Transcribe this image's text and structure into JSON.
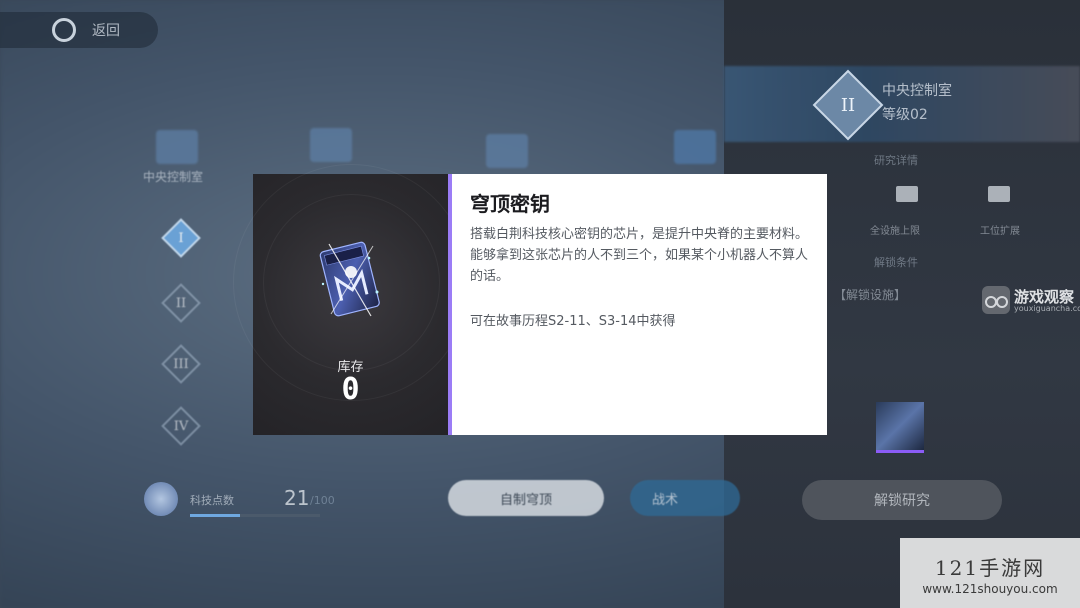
{
  "back": {
    "label": "返回"
  },
  "tree": {
    "categories": [
      "中央控制室",
      "",
      "",
      ""
    ],
    "levels": [
      "I",
      "II",
      "III",
      "IV"
    ]
  },
  "points": {
    "label": "科技点数",
    "value": "21",
    "max": "/100"
  },
  "buttons": {
    "self_made": "自制穹顶",
    "battle": "战术"
  },
  "right_panel": {
    "title": "中央控制室",
    "subtitle": "等级02",
    "level_numeral": "II",
    "research_header": "研究详情",
    "items": [
      "全设施上限",
      "工位扩展"
    ],
    "unlock_header": "解锁条件",
    "condition": "【解锁设施】",
    "unlock_button": "解锁研究"
  },
  "dialog": {
    "stock_label": "库存",
    "stock_value": "0",
    "title": "穹顶密钥",
    "description": "搭载白荆科技核心密钥的芯片，是提升中央脊的主要材料。能够拿到这张芯片的人不到三个，如果某个小机器人不算人的话。",
    "source": "可在故事历程S2-11、S3-14中获得",
    "accent_color": "#9b7cf6"
  },
  "watermarks": {
    "site1_name": "游戏观察",
    "site1_url": "youxiguancha.com",
    "site2_name": "121手游网",
    "site2_url": "www.121shouyou.com"
  }
}
